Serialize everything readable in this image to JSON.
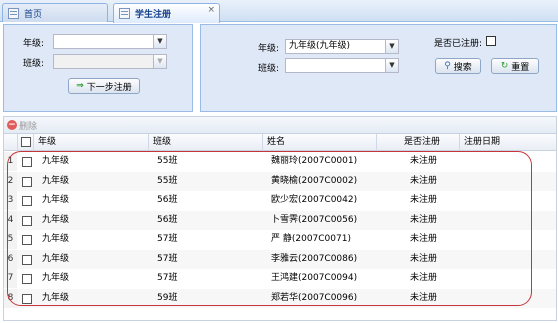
{
  "tabs": [
    {
      "label": "首页"
    },
    {
      "label": "学生注册",
      "close": "×"
    }
  ],
  "left_filter": {
    "grade_label": "年级:",
    "grade_value": "",
    "class_label": "班级:",
    "class_value": "",
    "next_button": "下一步注册"
  },
  "right_filter": {
    "grade_label": "年级:",
    "grade_value": "九年级(九年级)",
    "class_label": "班级:",
    "class_value": "",
    "registered_label": "是否已注册:",
    "search_button": "搜索",
    "reset_button": "重置"
  },
  "toolbar": {
    "delete_label": "删除"
  },
  "grid": {
    "columns": [
      "年级",
      "班级",
      "姓名",
      "是否注册",
      "注册日期"
    ],
    "rows": [
      {
        "num": "1",
        "grade": "九年级",
        "class": "55班",
        "name": "魏丽玲(2007C0001)",
        "status": "未注册",
        "date": ""
      },
      {
        "num": "2",
        "grade": "九年级",
        "class": "55班",
        "name": "黄晓榆(2007C0002)",
        "status": "未注册",
        "date": ""
      },
      {
        "num": "3",
        "grade": "九年级",
        "class": "56班",
        "name": "欧少宏(2007C0042)",
        "status": "未注册",
        "date": ""
      },
      {
        "num": "4",
        "grade": "九年级",
        "class": "56班",
        "name": "卜雪霁(2007C0056)",
        "status": "未注册",
        "date": ""
      },
      {
        "num": "5",
        "grade": "九年级",
        "class": "57班",
        "name": "严  静(2007C0071)",
        "status": "未注册",
        "date": ""
      },
      {
        "num": "6",
        "grade": "九年级",
        "class": "57班",
        "name": "李雅云(2007C0086)",
        "status": "未注册",
        "date": ""
      },
      {
        "num": "7",
        "grade": "九年级",
        "class": "57班",
        "name": "王鸿建(2007C0094)",
        "status": "未注册",
        "date": ""
      },
      {
        "num": "8",
        "grade": "九年级",
        "class": "59班",
        "name": "郑若华(2007C0096)",
        "status": "未注册",
        "date": ""
      }
    ]
  },
  "colors": {
    "annotation": "#c7353b",
    "header_text": "#15428b",
    "panel_bg": "#dfe8f6"
  }
}
